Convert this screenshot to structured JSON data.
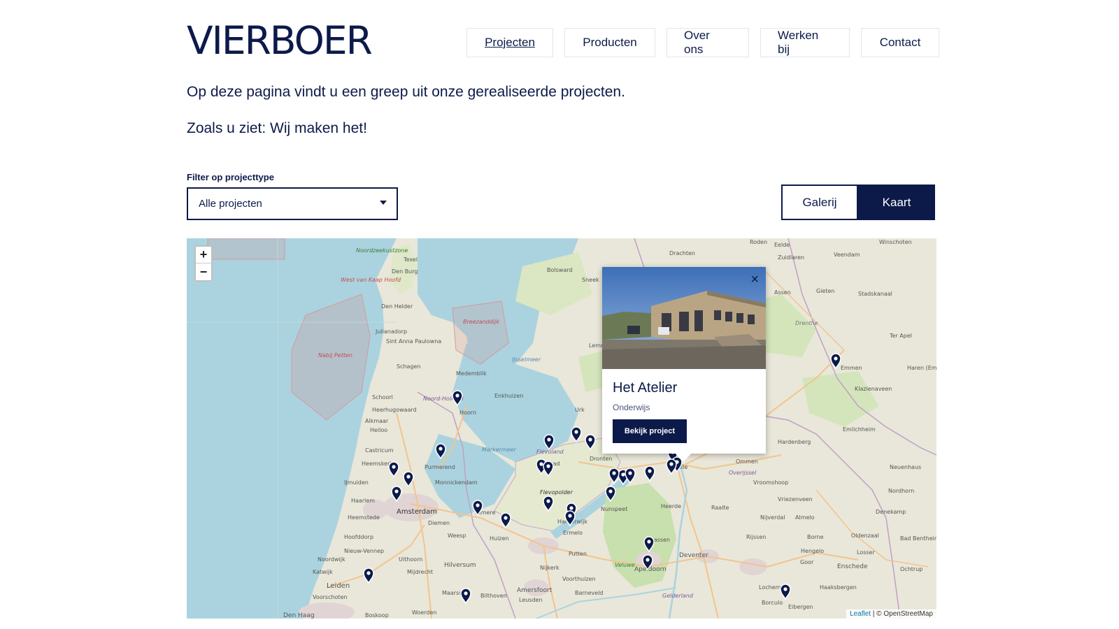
{
  "header": {
    "logo": "VIERBOER",
    "nav": [
      "Projecten",
      "Producten",
      "Over ons",
      "Werken bij",
      "Contact"
    ]
  },
  "intro": {
    "line1": "Op deze pagina vindt u een greep uit onze gerealiseerde projecten.",
    "line2": "Zoals u ziet: Wij maken het!"
  },
  "filter": {
    "label": "Filter op projecttype",
    "selected": "Alle projecten"
  },
  "view_toggle": {
    "gallery": "Galerij",
    "map": "Kaart"
  },
  "map": {
    "zoom_in": "+",
    "zoom_out": "−",
    "attribution_leaflet": "Leaflet",
    "attribution_osm": " | © OpenStreetMap",
    "place_labels": [
      "Noordzeekustzone",
      "Texel",
      "Den Burg",
      "West van Kaap Hoofd",
      "Den Helder",
      "Julianadorp",
      "Breezanddijk",
      "Sneek",
      "Bolsward",
      "Drachten",
      "Roden",
      "Eelde",
      "Zuidlaren",
      "Veendam",
      "Winschoten",
      "Assen",
      "Gieten",
      "Stadskanaal",
      "Drenthe",
      "Ter Apel",
      "Emmen",
      "Klazienaveen",
      "Haren (Em",
      "Nabij Petten",
      "Sint Anna Paulowna",
      "Schagen",
      "Medemblik",
      "IJsselmeer",
      "Lemmer",
      "Noord-Holland",
      "Enkhuizen",
      "Schoorl",
      "Heerhugowaard",
      "Hoorn",
      "Urk",
      "Alkmaar",
      "Heiloo",
      "Castricum",
      "Heemskerk",
      "Purmerend",
      "Markermeer",
      "Flevoland",
      "Lelystad",
      "Dronten",
      "Zwolle",
      "Ommen",
      "Hardenberg",
      "Emlichheim",
      "Neuenhaus",
      "Overijssel",
      "Vroomshoop",
      "Nordhorn",
      "IJmuiden",
      "Monnickendam",
      "Flevopolder",
      "Vriezenveen",
      "Denekamp",
      "Haarlem",
      "Amsterdam",
      "Heemstede",
      "Almere",
      "Nunspeet",
      "Heerde",
      "Raalte",
      "Nijverdal",
      "Almelo",
      "Hoofddorp",
      "Diemen",
      "Weesp",
      "Huizen",
      "Harderwijk",
      "Ermelo",
      "Vaassen",
      "Rijssen",
      "Borne",
      "Oldenzaal",
      "Bad Bentheim",
      "Nieuw-Vennep",
      "Uithoorn",
      "Hilversum",
      "Putten",
      "Deventer",
      "Hengelo",
      "Losser",
      "Noordwijk",
      "Katwijk",
      "Mijdrecht",
      "Nijkerk",
      "Veluwe",
      "Apeldoorn",
      "Goor",
      "Enschede",
      "Ochtrup",
      "Leiden",
      "Voorschoten",
      "Amersfoort",
      "Leusden",
      "Voorthuizen",
      "Barneveld",
      "Gelderland",
      "Lochem",
      "Haaksbergen",
      "Den Haag",
      "Boskoop",
      "Woerden",
      "Maarssen",
      "Bilthoven",
      "Borculo",
      "Eibergen"
    ]
  },
  "popup": {
    "title": "Het Atelier",
    "category": "Onderwijs",
    "button": "Bekijk project",
    "close": "×"
  }
}
